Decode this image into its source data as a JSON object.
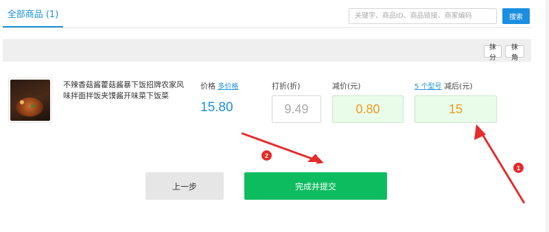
{
  "tabs": {
    "active_label": "全部商品 (1)"
  },
  "search": {
    "placeholder": "关键字、商品ID、商品链接、商家编码",
    "button_label": "搜索"
  },
  "toolbar": {
    "round_fen_label": "抹分",
    "round_jiao_label": "抹角"
  },
  "product": {
    "title": "不辣香菇酱藿菇酱暴下饭招牌农家风味拌面拌饭夹馍酱开味菜下饭菜",
    "price_label": "价格",
    "multi_price_link": "多价格",
    "price_value": "15.80",
    "discount_label": "打折(折)",
    "discount_value": "9.49",
    "reduce_label": "减价(元)",
    "reduce_value": "0.80",
    "variants_link": "5 个型号",
    "after_label": "减后(元)",
    "after_value": "15"
  },
  "actions": {
    "prev_label": "上一步",
    "submit_label": "完成并提交"
  },
  "annotations": {
    "badge1": "1",
    "badge2": "2"
  },
  "colors": {
    "accent": "#1a8fe0",
    "submit_green": "#0ebc60",
    "highlight_orange": "#ef9b1b",
    "annotation_red": "#e52b2b"
  }
}
